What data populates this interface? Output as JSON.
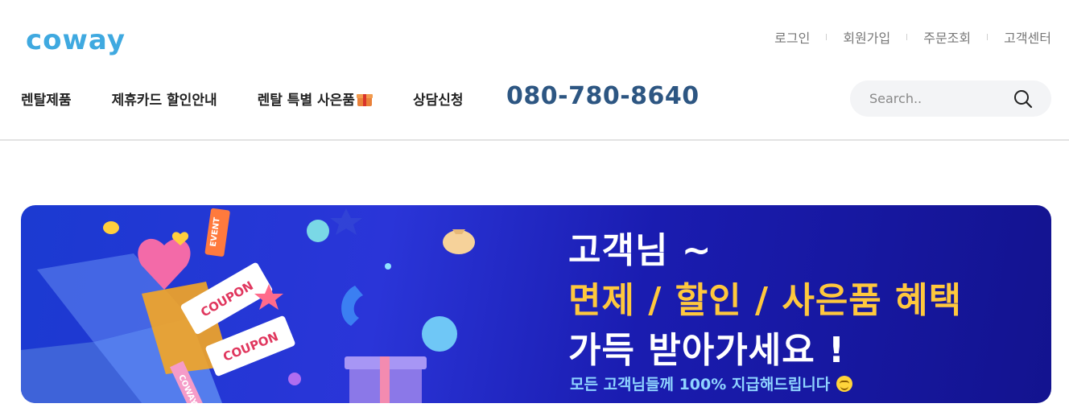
{
  "brand": {
    "logo_text": "coway",
    "logo_color": "#3fa9e0"
  },
  "util_nav": {
    "items": [
      {
        "label": "로그인"
      },
      {
        "label": "회원가입"
      },
      {
        "label": "주문조회"
      },
      {
        "label": "고객센터"
      }
    ]
  },
  "gnb": {
    "items": [
      {
        "label": "렌탈제품"
      },
      {
        "label": "제휴카드 할인안내"
      },
      {
        "label": "렌탈 특별 사은품",
        "icon": "gift-icon"
      },
      {
        "label": "상담신청"
      }
    ]
  },
  "phone": {
    "number": "080-780-8640",
    "color": "#2d5682"
  },
  "search": {
    "placeholder": "Search..",
    "icon": "search-icon"
  },
  "banner": {
    "line1": "고객님 ~",
    "line2": "면제 / 할인 / 사은품 혜택",
    "line3": "가득 받아가세요 !",
    "line4": "모든 고객님들께 100% 지급해드립니다",
    "art_labels": {
      "event": "EVENT",
      "coupon1": "COUPON",
      "coupon2": "COUPON",
      "box": "COWAY"
    },
    "colors": {
      "background": "#1a2bc4",
      "highlight": "#ffc83d",
      "subtext": "#8fd4ff"
    }
  }
}
